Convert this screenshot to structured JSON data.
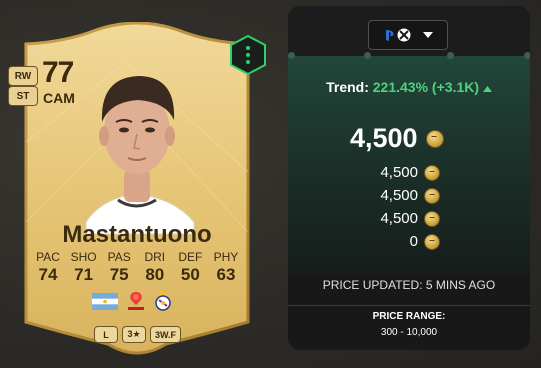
{
  "card": {
    "rating": "77",
    "position": "CAM",
    "alt_positions": [
      "RW",
      "ST"
    ],
    "name": "Mastantuono",
    "stats": [
      {
        "label": "PAC",
        "value": "74"
      },
      {
        "label": "SHO",
        "value": "71"
      },
      {
        "label": "PAS",
        "value": "75"
      },
      {
        "label": "DRI",
        "value": "80"
      },
      {
        "label": "DEF",
        "value": "50"
      },
      {
        "label": "PHY",
        "value": "63"
      }
    ],
    "nation": "argentina-flag-icon",
    "league": "laliga-icon",
    "club": "real-madrid-crest-icon",
    "badges": {
      "foot": "L",
      "skills": "3★",
      "weak_foot": "3W.F"
    },
    "menu_icon": "vertical-dots-icon"
  },
  "panel": {
    "platform_icons": [
      "playstation-icon",
      "xbox-icon"
    ],
    "trend_label": "Trend:",
    "trend_value": "221.43% (+3.1K)",
    "trend_direction": "up",
    "main_price": "4,500",
    "prices": [
      "4,500",
      "4,500",
      "4,500",
      "0"
    ],
    "updated": "PRICE UPDATED: 5 MINS AGO",
    "range_label": "PRICE RANGE:",
    "range_value": "300 - 10,000"
  },
  "colors": {
    "card_gold": "#e8c879",
    "card_text": "#3b2a10",
    "trend_green": "#4ed37e",
    "panel_bg": "#181818",
    "panel_green": "#22463a"
  }
}
